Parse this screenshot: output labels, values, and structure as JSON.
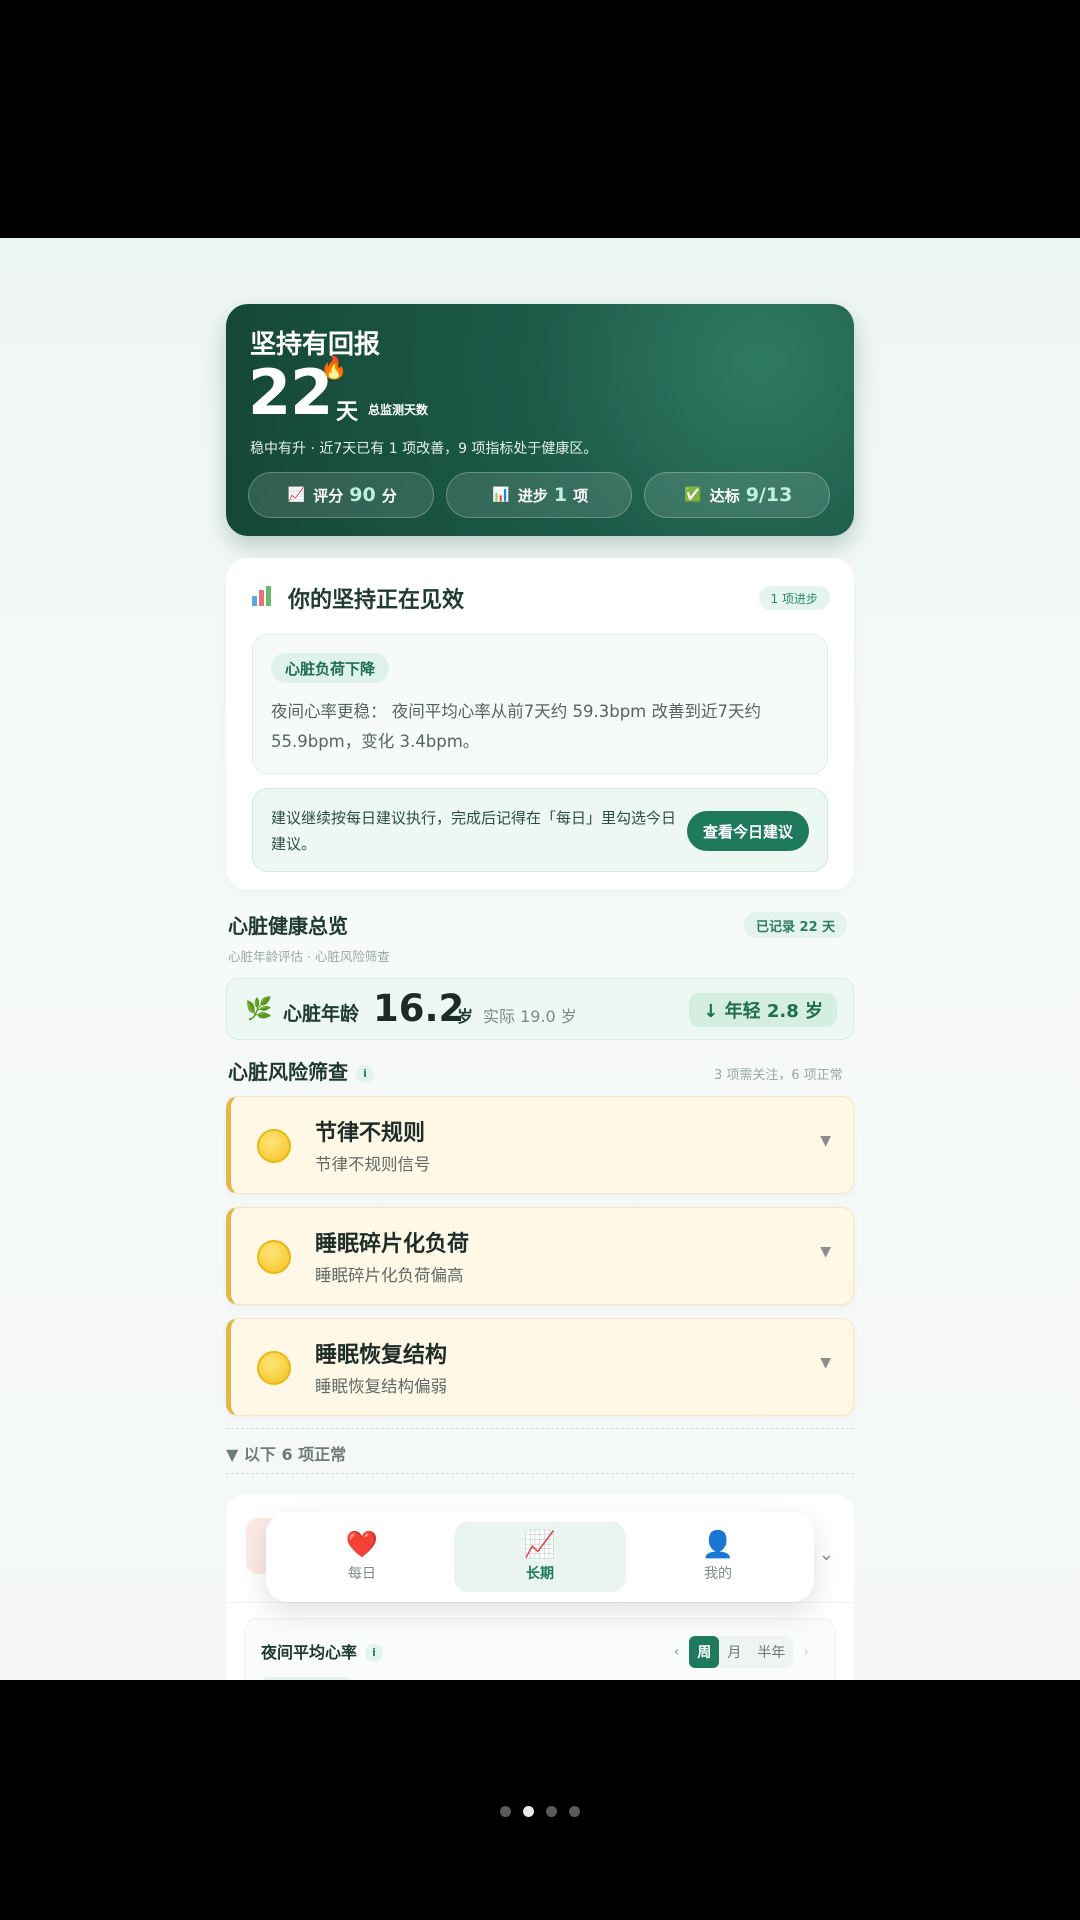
{
  "hero": {
    "title": "坚持有回报",
    "days": "22",
    "fire_icon": "🔥",
    "days_unit": "天",
    "days_label": "总监测天数",
    "description": "稳中有升 · 近7天已有 1 项改善，9 项指标处于健康区。",
    "pills": [
      {
        "icon": "📈",
        "label": "评分",
        "value": "90",
        "unit": "分"
      },
      {
        "icon": "📊",
        "label": "进步",
        "value": "1",
        "unit": "项"
      },
      {
        "icon": "✅",
        "label": "达标",
        "value": "9/13",
        "unit": ""
      }
    ]
  },
  "progress_card": {
    "title": "你的坚持正在见效",
    "badge": "1 项进步",
    "insight": {
      "tag": "心脏负荷下降",
      "text": "夜间心率更稳： 夜间平均心率从前7天约 59.3bpm 改善到近7天约 55.9bpm，变化 3.4bpm。"
    },
    "suggestion": {
      "text": "建议继续按每日建议执行，完成后记得在「每日」里勾选今日建议。",
      "button": "查看今日建议"
    }
  },
  "heart_overview": {
    "title": "心脏健康总览",
    "subtitle": "心脏年龄评估 · 心脏风险筛查",
    "badge": "已记录 22 天",
    "age": {
      "leaf_icon": "🌿",
      "label": "心脏年龄",
      "value": "16.2",
      "unit": "岁",
      "actual": "实际 19.0 岁",
      "younger": "↓ 年轻 2.8 岁"
    }
  },
  "risk_screening": {
    "title": "心脏风险筛查",
    "info": "i",
    "summary": "3 项需关注，6 项正常",
    "items": [
      {
        "name": "节律不规则",
        "desc": "节律不规则信号",
        "status_color": "#f2c21e"
      },
      {
        "name": "睡眠碎片化负荷",
        "desc": "睡眠碎片化负荷偏高",
        "status_color": "#f2c21e"
      },
      {
        "name": "睡眠恢复结构",
        "desc": "睡眠恢复结构偏弱",
        "status_color": "#f2c21e"
      }
    ],
    "normal_toggle": "▼ 以下 6 项正常"
  },
  "detail_card": {
    "title": "夜间平均心率",
    "info": "i",
    "periods": [
      "周",
      "月",
      "半年"
    ],
    "active_period": "周"
  },
  "tabbar": {
    "tabs": [
      {
        "icon": "❤️",
        "label": "每日"
      },
      {
        "icon": "📈",
        "label": "长期"
      },
      {
        "icon": "👤",
        "label": "我的"
      }
    ],
    "active": "长期"
  },
  "pager": {
    "count": 4,
    "active_index": 1
  },
  "colors": {
    "accent": "#1f7a5d",
    "hero_bg": "#1d5b49",
    "warning": "#e3b84a"
  }
}
